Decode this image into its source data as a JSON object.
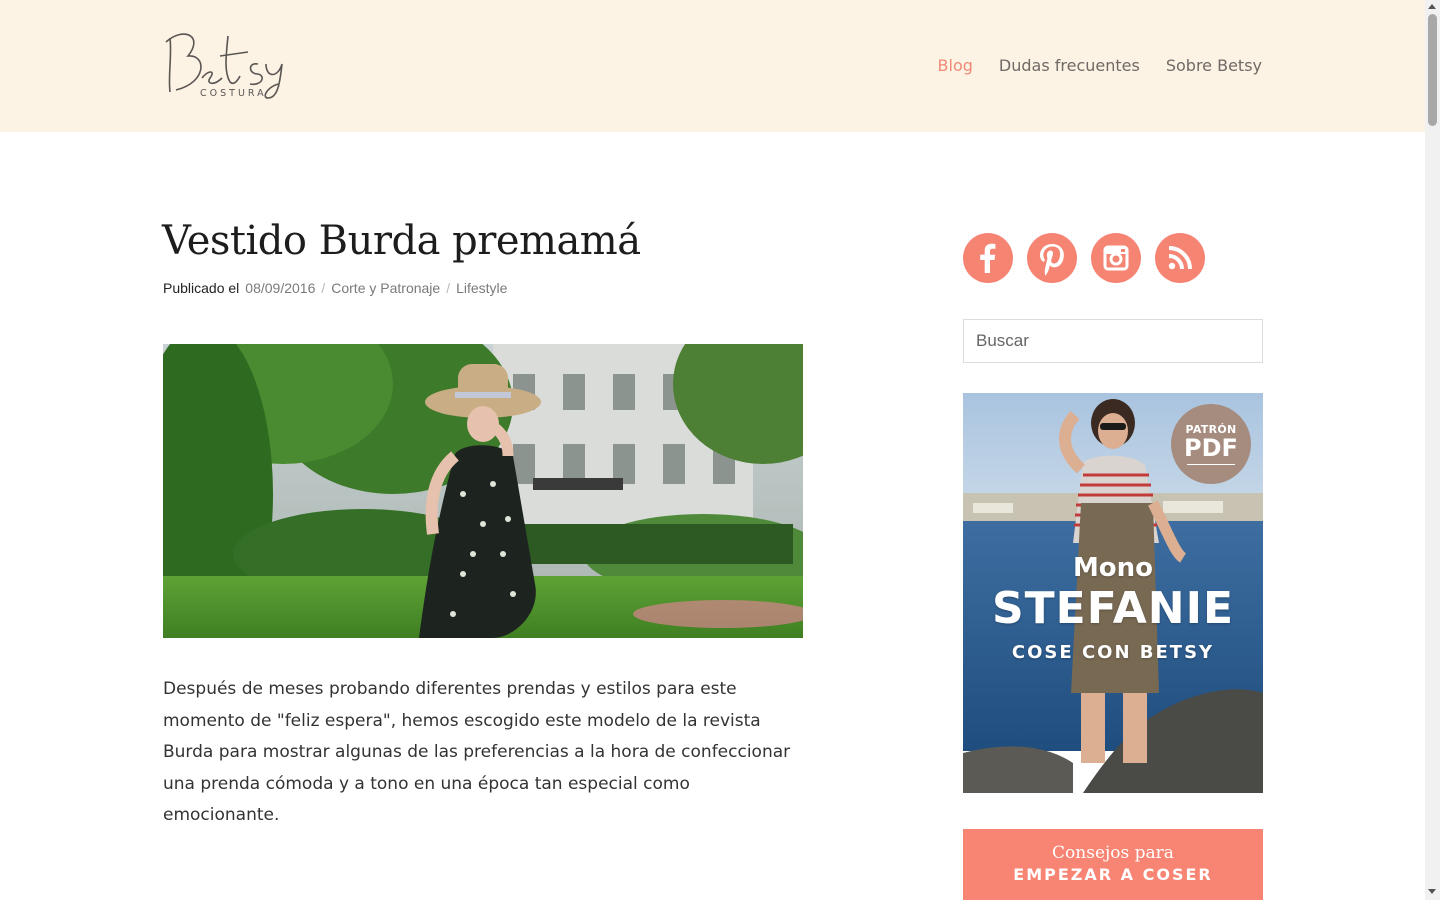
{
  "site": {
    "logo_script": "Betsy",
    "logo_sub": "COSTURA"
  },
  "nav": {
    "items": [
      {
        "label": "Blog",
        "active": true
      },
      {
        "label": "Dudas frecuentes",
        "active": false
      },
      {
        "label": "Sobre Betsy",
        "active": false
      }
    ]
  },
  "post": {
    "title": "Vestido Burda premamá",
    "meta_label": "Publicado el",
    "date": "08/09/2016",
    "categories": [
      "Corte y Patronaje",
      "Lifestyle"
    ],
    "separator": "/",
    "image_alt": "Mujer embarazada con sombrero y vestido de flores en un jardín",
    "body": "Después de meses probando diferentes prendas y estilos para este momento de \"feliz espera\", hemos escogido este modelo de la revista Burda para mostrar algunas de las preferencias a la hora de confeccionar una prenda cómoda y a tono en una época tan especial como emocionante."
  },
  "sidebar": {
    "social": [
      {
        "name": "facebook-icon"
      },
      {
        "name": "pinterest-icon"
      },
      {
        "name": "instagram-icon"
      },
      {
        "name": "rss-icon"
      }
    ],
    "search_placeholder": "Buscar",
    "ad": {
      "badge_line1": "PATRÓN",
      "badge_line2": "PDF",
      "line1": "Mono",
      "line2": "STEFANIE",
      "line3": "COSE CON BETSY"
    },
    "cta": {
      "line1": "Consejos para",
      "line2": "EMPEZAR A COSER"
    }
  },
  "colors": {
    "accent": "#f58572",
    "header_bg": "#fcf3e4",
    "nav_active": "#f08a77",
    "badge": "#a58c7e"
  }
}
